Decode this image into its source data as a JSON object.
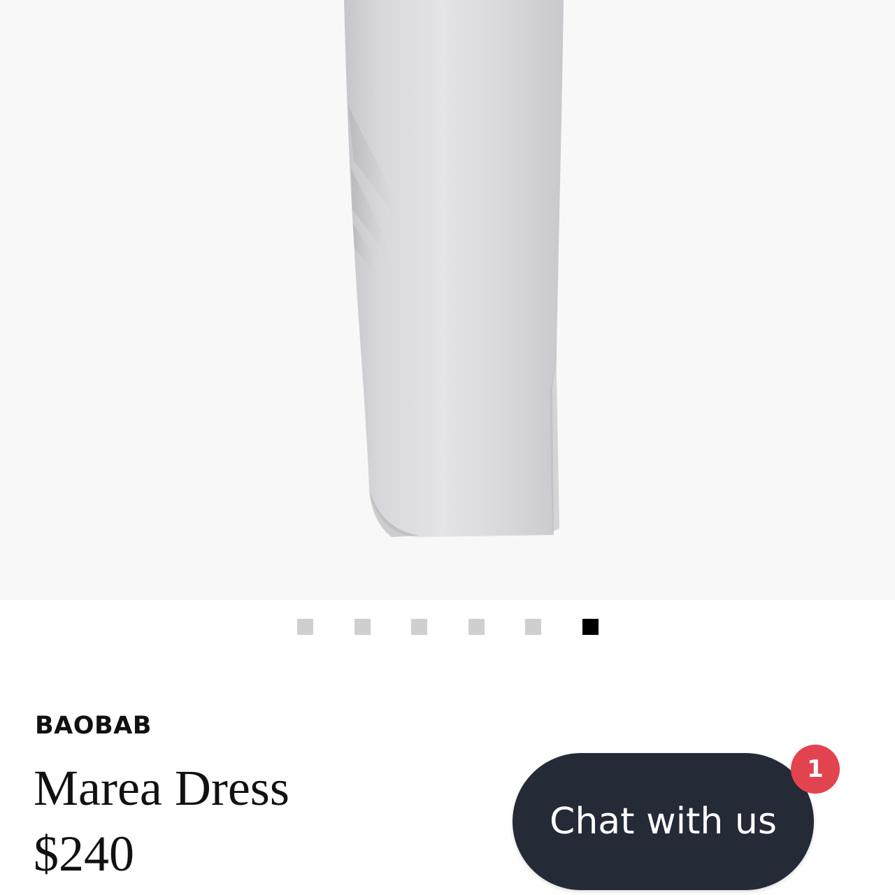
{
  "product": {
    "brand": "BAOBAB",
    "title": "Marea Dress",
    "price": "$240",
    "image_alt": "product-photo-silver-satin-dress-hem"
  },
  "gallery": {
    "total": 6,
    "active_index": 5
  },
  "chat": {
    "label": "Chat with us",
    "badge_count": "1"
  },
  "colors": {
    "hero_background": "#f8f8f8",
    "dot_inactive": "#cfcfcf",
    "dot_active": "#000000",
    "chat_background": "#242a36",
    "badge_background": "#e2444f"
  }
}
